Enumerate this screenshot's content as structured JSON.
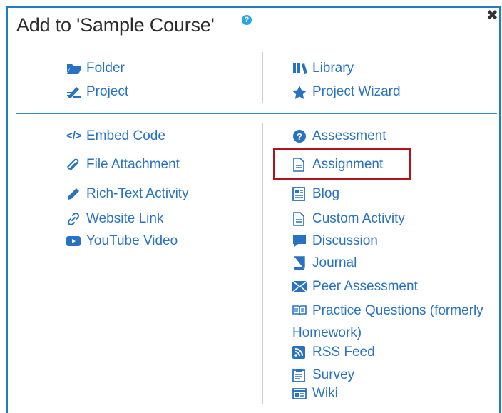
{
  "dialog": {
    "title": "Add to 'Sample Course'",
    "help_icon": "question-circle-icon",
    "close_icon": "close-icon",
    "accent_color": "#1f7dc0",
    "link_color": "#2773c2",
    "highlight_color": "#b0151e"
  },
  "top_left": [
    {
      "label": "Folder",
      "icon": "folder-icon"
    },
    {
      "label": "Project",
      "icon": "project-icon"
    }
  ],
  "top_right": [
    {
      "label": "Library",
      "icon": "library-icon"
    },
    {
      "label": "Project Wizard",
      "icon": "star-icon"
    }
  ],
  "materials": [
    {
      "label": "Embed Code",
      "icon": "code-icon"
    },
    {
      "label": "File Attachment",
      "icon": "paperclip-icon"
    },
    {
      "label": "Rich-Text Activity",
      "icon": "pencil-icon"
    },
    {
      "label": "Website Link",
      "icon": "link-icon"
    },
    {
      "label": "YouTube Video",
      "icon": "youtube-icon"
    }
  ],
  "activities": [
    {
      "label": "Assessment",
      "icon": "question-circle-icon"
    },
    {
      "label": "Assignment",
      "icon": "document-icon",
      "highlighted": true
    },
    {
      "label": "Blog",
      "icon": "blog-icon"
    },
    {
      "label": "Custom Activity",
      "icon": "document-icon"
    },
    {
      "label": "Discussion",
      "icon": "comment-icon"
    },
    {
      "label": "Journal",
      "icon": "book-icon"
    },
    {
      "label": "Peer Assessment",
      "icon": "envelope-icon"
    },
    {
      "label": "Practice Questions (formerly Homework)",
      "icon": "open-book-icon"
    },
    {
      "label": "RSS Feed",
      "icon": "rss-icon"
    },
    {
      "label": "Survey",
      "icon": "clipboard-icon"
    },
    {
      "label": "Wiki",
      "icon": "wiki-icon"
    }
  ]
}
